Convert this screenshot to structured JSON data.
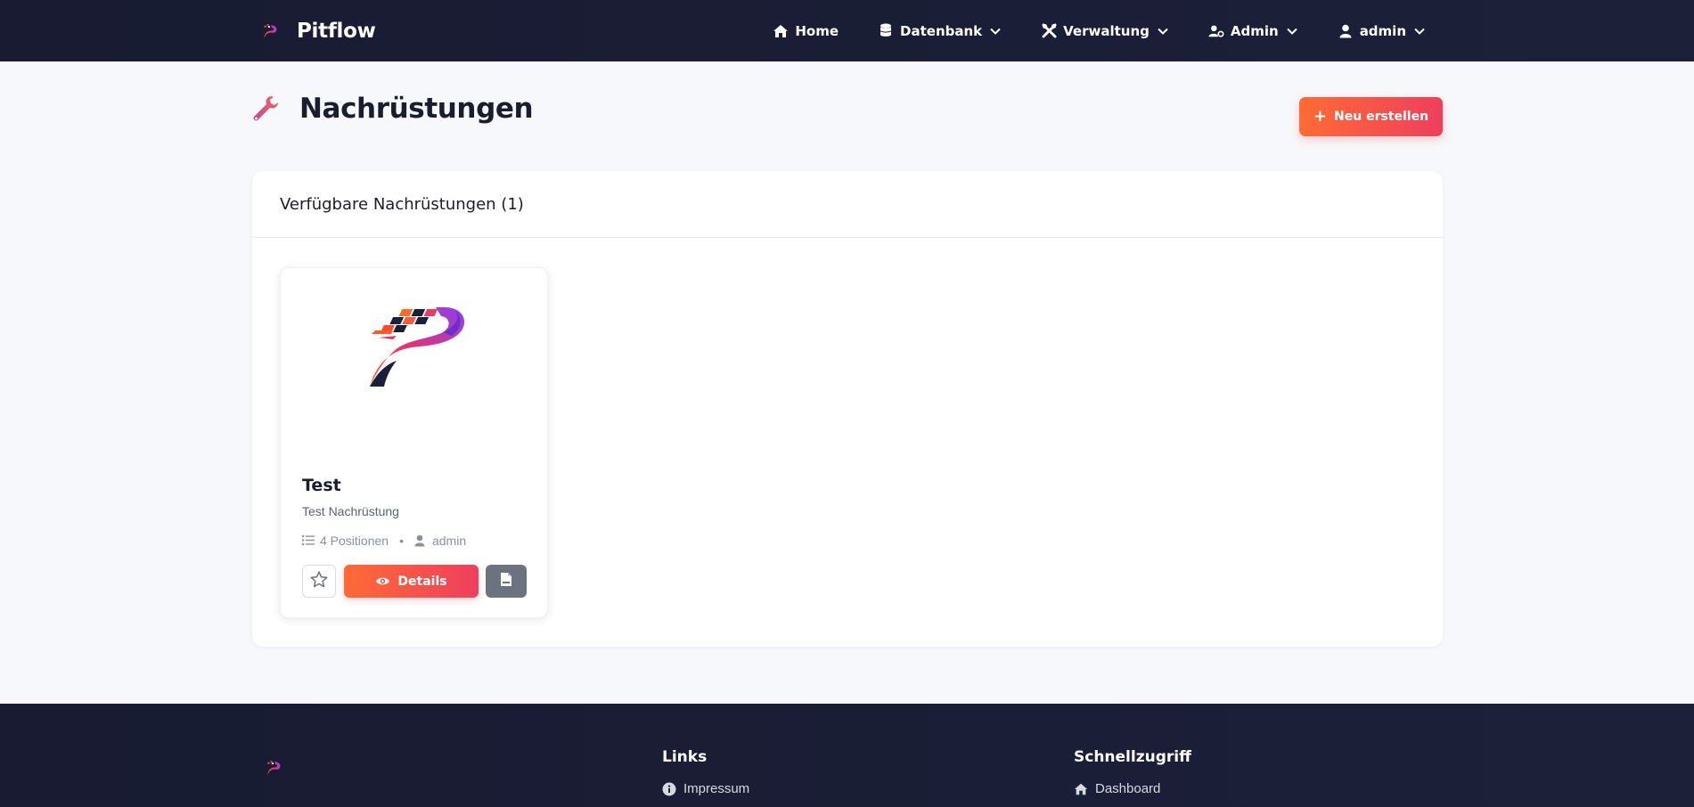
{
  "brand": {
    "name": "Pitflow"
  },
  "nav": {
    "items": [
      {
        "label": "Home",
        "icon": "home-icon",
        "dropdown": false
      },
      {
        "label": "Datenbank",
        "icon": "database-icon",
        "dropdown": true
      },
      {
        "label": "Verwaltung",
        "icon": "tools-icon",
        "dropdown": true
      },
      {
        "label": "Admin",
        "icon": "user-cog-icon",
        "dropdown": true
      },
      {
        "label": "admin",
        "icon": "user-icon",
        "dropdown": true
      }
    ]
  },
  "page": {
    "title": "Nachrüstungen",
    "new_button": "Neu erstellen"
  },
  "panel": {
    "title": "Verfügbare Nachrüstungen (1)"
  },
  "cards": [
    {
      "title": "Test",
      "description": "Test Nachrüstung",
      "positions": "4 Positionen",
      "separator": "•",
      "author": "admin",
      "details_label": "Details"
    }
  ],
  "footer": {
    "links_title": "Links",
    "links": [
      {
        "label": "Impressum",
        "icon": "info-icon"
      }
    ],
    "quick_title": "Schnellzugriff",
    "quick": [
      {
        "label": "Dashboard",
        "icon": "home-icon"
      }
    ]
  },
  "colors": {
    "nav_bg": "#181b31",
    "accent_start": "#ff6b35",
    "accent_end": "#ee3f5e",
    "page_bg": "#f7f8fb"
  }
}
